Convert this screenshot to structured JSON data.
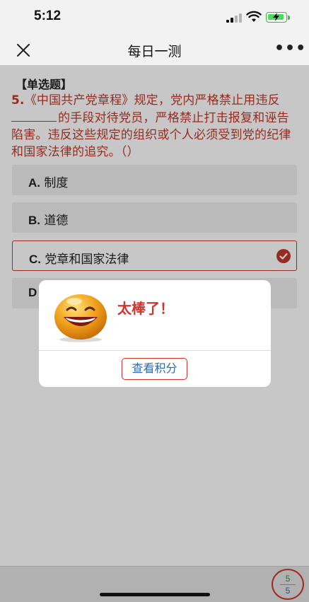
{
  "status_bar": {
    "time": "5:12"
  },
  "nav": {
    "title": "每日一测",
    "more": "•••"
  },
  "question": {
    "type": "【单选题】",
    "number": "5.",
    "text_before_blank": "《中国共产党章程》规定，党内严格禁止用违反",
    "text_after_blank": "的手段对待党员，严格禁止打击报复和诬告陷害。违反这些规定的组织或个人必须受到党的纪律和国家法律的追究。（）"
  },
  "options": [
    {
      "letter": "A.",
      "text": "制度",
      "selected": false
    },
    {
      "letter": "B.",
      "text": "道德",
      "selected": false
    },
    {
      "letter": "C.",
      "text": "党章和国家法律",
      "selected": true
    },
    {
      "letter": "D",
      "text": "",
      "selected": false
    }
  ],
  "dialog": {
    "message": "太棒了！",
    "button_label": "查看积分"
  },
  "counter": {
    "answered": "5",
    "total": "5"
  },
  "colors": {
    "accent": "#d0342c",
    "link": "#2b6cb0",
    "question_text": "#c0392b"
  }
}
